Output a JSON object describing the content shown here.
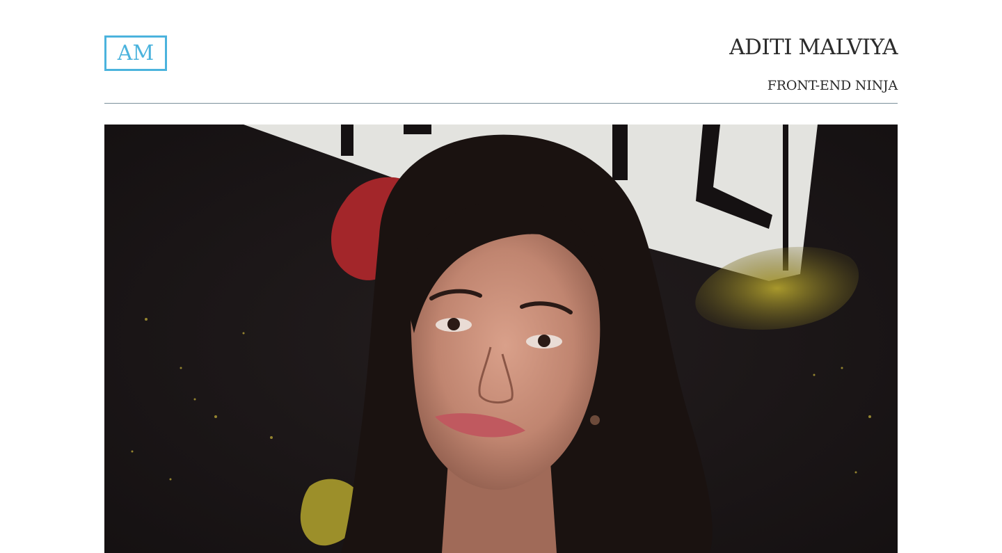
{
  "header": {
    "logo_text": "AM",
    "title": "ADITI MALVIYA",
    "subtitle": "FRONT-END NINJA"
  },
  "hero": {
    "image_alt": "Portrait photo",
    "palette": {
      "wall": "#1b1718",
      "paint_white": "#e6e6e2",
      "paint_red": "#a3262a",
      "paint_yellow": "#9c8f2a",
      "hair": "#1a1210",
      "skin": "#c48a74",
      "lips": "#c0595f"
    }
  },
  "colors": {
    "accent": "#4bb3dd",
    "divider": "#7a8f9a",
    "text": "#2b2b2b"
  }
}
